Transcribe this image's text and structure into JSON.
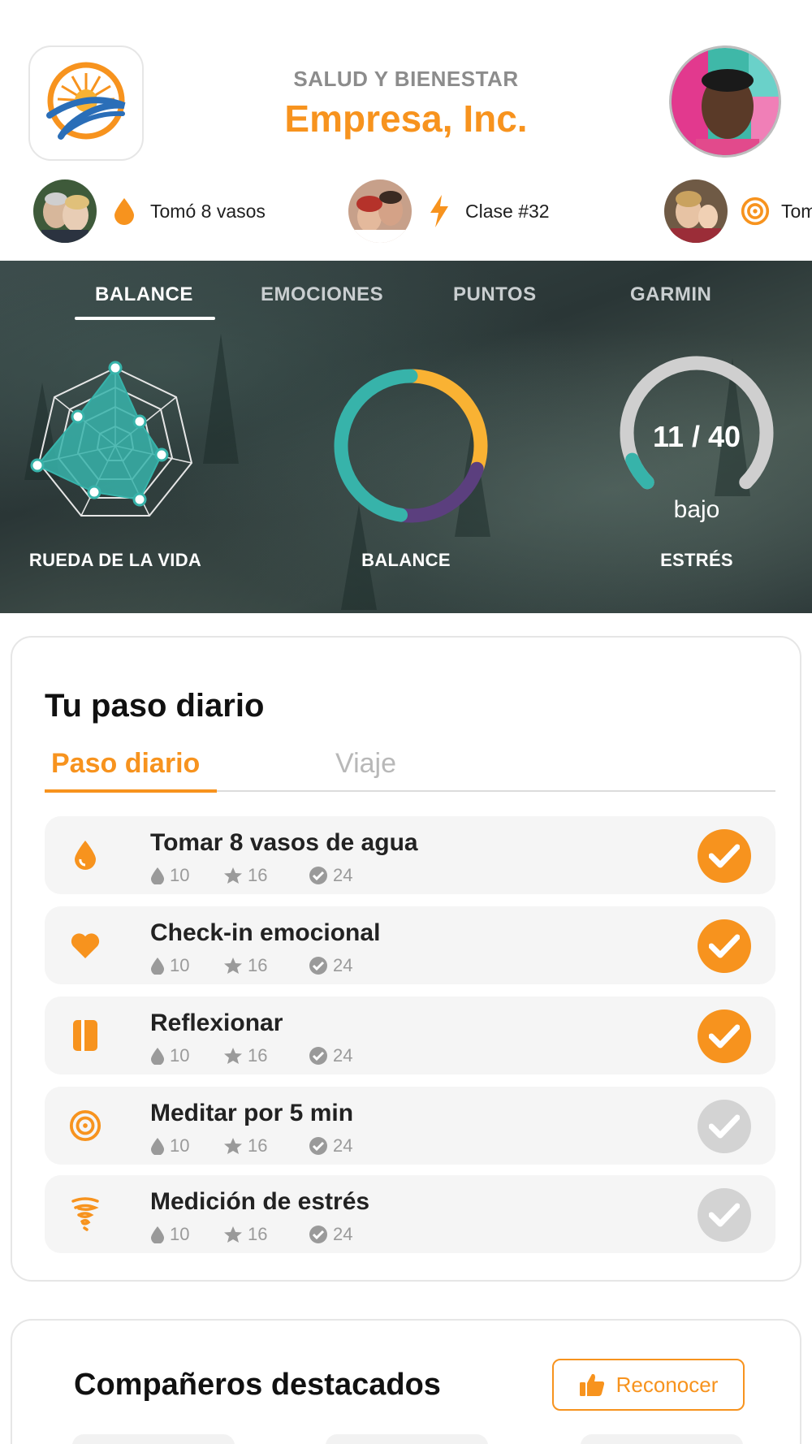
{
  "header": {
    "subtitle": "SALUD Y BIENESTAR",
    "company": "Empresa, Inc."
  },
  "feed": [
    {
      "icon": "water-drop-icon",
      "text": "Tomó 8 vasos"
    },
    {
      "icon": "lightning-icon",
      "text": "Clase #32"
    },
    {
      "icon": "target-icon",
      "text": "Tomó"
    }
  ],
  "hero": {
    "tabs": [
      "BALANCE",
      "EMOCIONES",
      "PUNTOS",
      "GARMIN"
    ],
    "active_tab": "BALANCE",
    "wheel_label": "RUEDA DE LA VIDA",
    "balance_label": "BALANCE",
    "stress_label": "ESTRÉS",
    "stress_value": "11 / 40",
    "stress_level": "bajo",
    "stress_fraction": 0.275,
    "balance_segments": [
      {
        "color": "#f9b233",
        "fraction": 0.3
      },
      {
        "color": "#5b3f7e",
        "fraction": 0.22
      },
      {
        "color": "#37b3aa",
        "fraction": 0.48
      }
    ]
  },
  "daily": {
    "title": "Tu paso diario",
    "tabs": [
      "Paso diario",
      "Viaje"
    ],
    "tasks": [
      {
        "title": "Tomar 8 vasos de agua",
        "icon": "water-drop-icon",
        "drops": "10",
        "stars": "16",
        "checks": "24",
        "done": true
      },
      {
        "title": "Check-in emocional",
        "icon": "heart-icon",
        "drops": "10",
        "stars": "16",
        "checks": "24",
        "done": true
      },
      {
        "title": "Reflexionar",
        "icon": "journal-icon",
        "drops": "10",
        "stars": "16",
        "checks": "24",
        "done": true
      },
      {
        "title": "Meditar por 5 min",
        "icon": "target-icon",
        "drops": "10",
        "stars": "16",
        "checks": "24",
        "done": false
      },
      {
        "title": "Medición de estrés",
        "icon": "tornado-icon",
        "drops": "10",
        "stars": "16",
        "checks": "24",
        "done": false
      }
    ]
  },
  "companions": {
    "title": "Compañeros destacados",
    "button_label": "Reconocer"
  },
  "colors": {
    "accent": "#f7931e",
    "teal": "#37b3aa",
    "purple": "#5b3f7e",
    "yellow": "#f9b233"
  }
}
